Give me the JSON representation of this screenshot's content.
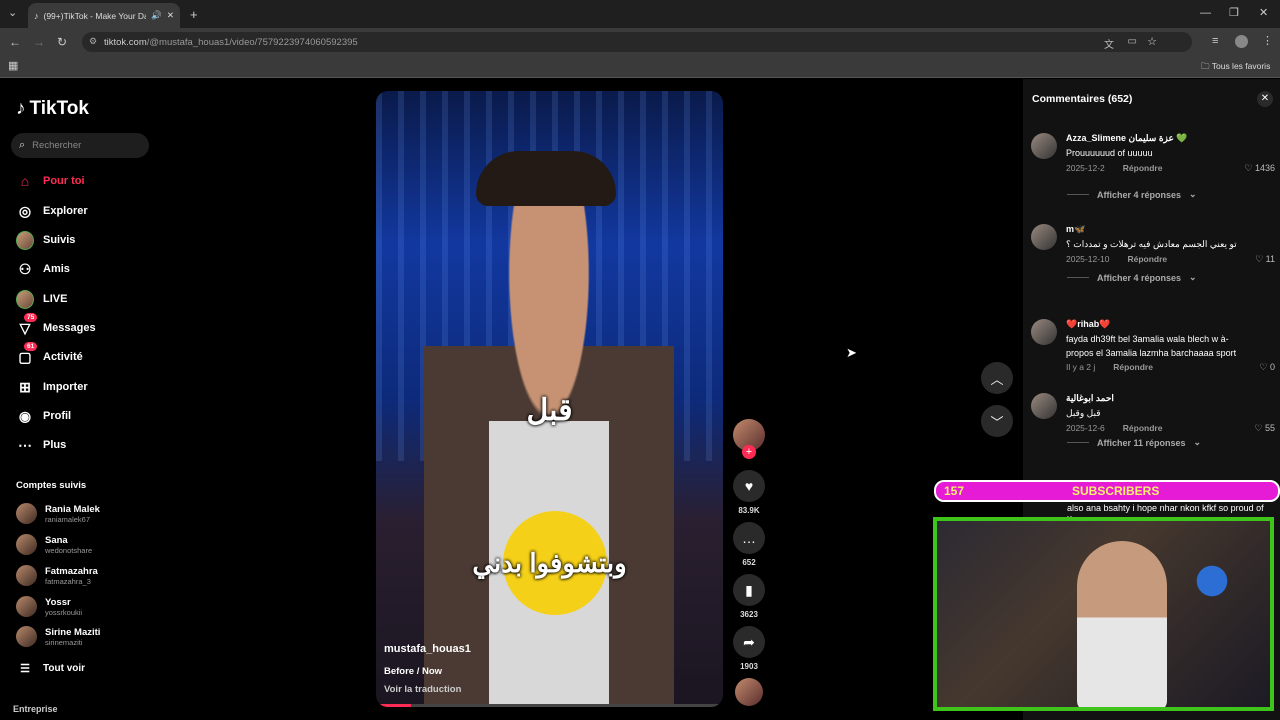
{
  "browser": {
    "tab_title": "(99+)TikTok - Make Your Da",
    "url_domain": "tiktok.com",
    "url_path": "/@mustafa_houas1/video/7579223974060592395",
    "bookmarks_label": "Tous les favoris"
  },
  "sidebar": {
    "logo": "TikTok",
    "search_placeholder": "Rechercher",
    "nav": [
      {
        "label": "Pour toi",
        "icon": "home-icon",
        "active": true
      },
      {
        "label": "Explorer",
        "icon": "compass-icon"
      },
      {
        "label": "Suivis",
        "icon": "following-avatar-icon"
      },
      {
        "label": "Amis",
        "icon": "friends-icon"
      },
      {
        "label": "LIVE",
        "icon": "live-icon"
      },
      {
        "label": "Messages",
        "icon": "messages-icon",
        "badge": "75"
      },
      {
        "label": "Activité",
        "icon": "activity-icon",
        "badge": "61"
      },
      {
        "label": "Importer",
        "icon": "upload-icon"
      },
      {
        "label": "Profil",
        "icon": "profile-icon"
      },
      {
        "label": "Plus",
        "icon": "more-icon"
      }
    ],
    "following_title": "Comptes suivis",
    "accounts": [
      {
        "name": "Rania Malek",
        "handle": "raniamalek67"
      },
      {
        "name": "Sana",
        "handle": "wedonotshare"
      },
      {
        "name": "Fatmazahra",
        "handle": "fatmazahra_3"
      },
      {
        "name": "Yossr",
        "handle": "yossrkoukii"
      },
      {
        "name": "Sirine Maziti",
        "handle": "sirinemaziti"
      }
    ],
    "see_all": "Tout voir",
    "footer": "Entreprise"
  },
  "video": {
    "subtitle_top": "قبل",
    "subtitle_bottom": "وبتشوفوا بدني",
    "author": "mustafa_houas1",
    "description": "Before / Now",
    "translate": "Voir la traduction",
    "progress": 0.1
  },
  "actions": {
    "likes": "83.9K",
    "comments": "652",
    "saves": "3623",
    "shares": "1903"
  },
  "comments_panel": {
    "title": "Commentaires",
    "count": "(652)",
    "comments": [
      {
        "user": "Azza_Slimene عزة سليمان 💚",
        "text": "Prouuuuuud of uuuuu",
        "date": "2025-12-2",
        "reply": "Répondre",
        "likes": "1436",
        "more": "Afficher 4 réponses"
      },
      {
        "user": "m🦋",
        "text": "تو يعني الجسم معادش فيه ترهلات و تمددات ؟",
        "date": "2025-12-10",
        "reply": "Répondre",
        "likes": "11",
        "more": "Afficher 4 réponses"
      },
      {
        "user": "❤️rihab❤️",
        "text": "fayda dh39ft bel 3amalia wala blech w à-propos el 3amalia lazmha barchaaaa sport",
        "date": "Il y a 2 j",
        "reply": "Répondre",
        "likes": "0",
        "more": ""
      },
      {
        "user": "احمد ابوغالية",
        "text": "قبل وقبل",
        "date": "2025-12-6",
        "reply": "Répondre",
        "likes": "55",
        "more": "Afficher 11 réponses"
      }
    ],
    "partial_comment": "also ana bsahty i hope nhar nkon kfkf so proud of u"
  },
  "stream_overlay": {
    "sub_count": "157",
    "sub_label": "SUBSCRIBERS"
  },
  "colors": {
    "accent": "#fe2c55",
    "overlay_magenta": "#e61bd6",
    "cam_border": "#3ec41a"
  }
}
